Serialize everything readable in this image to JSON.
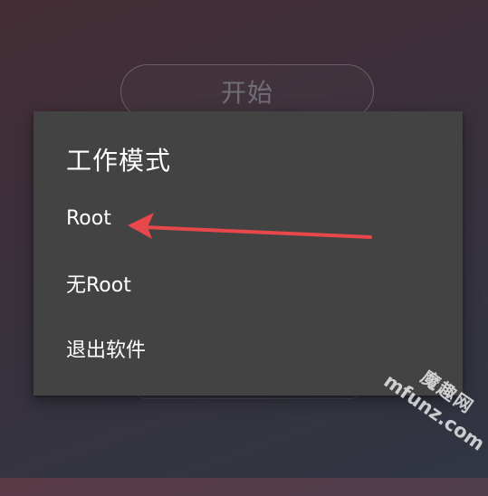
{
  "background": {
    "start_button_label": "开始"
  },
  "dialog": {
    "title": "工作模式",
    "options": [
      {
        "label": "Root"
      },
      {
        "label": "无Root"
      },
      {
        "label": "退出软件"
      }
    ]
  },
  "annotation": {
    "arrow_color": "#e8474b"
  },
  "watermark": {
    "line1": "魔趣网",
    "line2": "mfunz.com"
  }
}
